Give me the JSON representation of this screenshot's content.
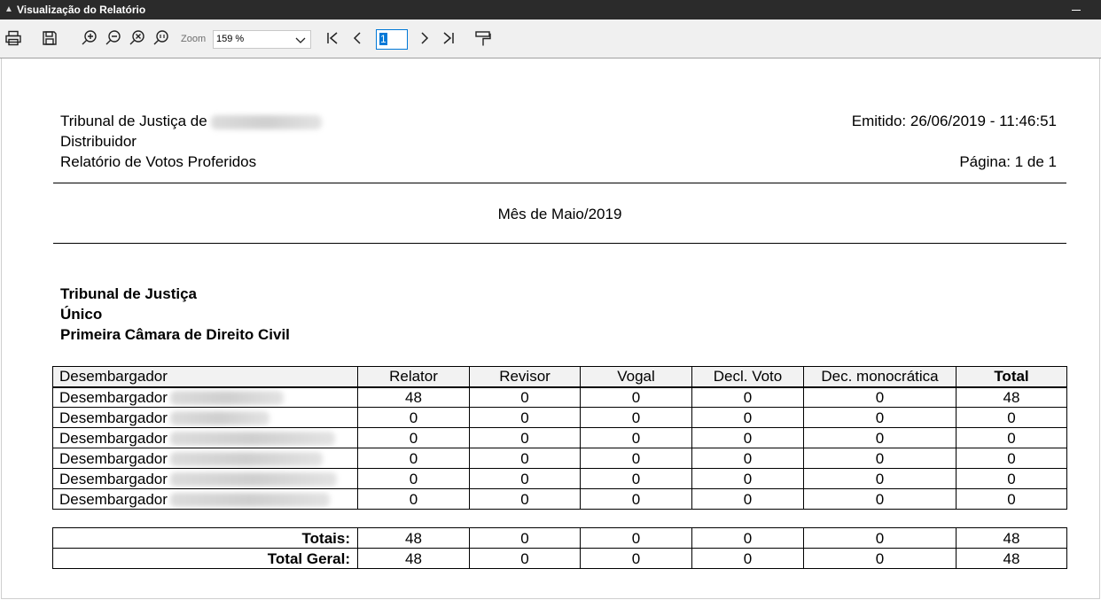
{
  "window": {
    "title": "Visualização do Relatório"
  },
  "toolbar": {
    "zoom_label": "Zoom",
    "zoom_value": "159 %",
    "page_value": "1"
  },
  "report": {
    "header": {
      "line1_prefix": "Tribunal de Justiça de",
      "line2": "Distribuidor",
      "line3": "Relatório de Votos Proferidos",
      "emitted": "Emitido: 26/06/2019 - 11:46:51",
      "page": "Página: 1 de 1"
    },
    "period": "Mês de Maio/2019",
    "section": {
      "line1": "Tribunal de Justiça",
      "line2": "Único",
      "line3": "Primeira Câmara de Direito Civil"
    },
    "table": {
      "columns": [
        "Desembargador",
        "Relator",
        "Revisor",
        "Vogal",
        "Decl. Voto",
        "Dec. monocrática",
        "Total"
      ],
      "rows": [
        {
          "name": "Desembargador",
          "values": [
            "48",
            "0",
            "0",
            "0",
            "0",
            "48"
          ]
        },
        {
          "name": "Desembargador",
          "values": [
            "0",
            "0",
            "0",
            "0",
            "0",
            "0"
          ]
        },
        {
          "name": "Desembargador",
          "values": [
            "0",
            "0",
            "0",
            "0",
            "0",
            "0"
          ]
        },
        {
          "name": "Desembargador",
          "values": [
            "0",
            "0",
            "0",
            "0",
            "0",
            "0"
          ]
        },
        {
          "name": "Desembargador",
          "values": [
            "0",
            "0",
            "0",
            "0",
            "0",
            "0"
          ]
        },
        {
          "name": "Desembargador",
          "values": [
            "0",
            "0",
            "0",
            "0",
            "0",
            "0"
          ]
        }
      ]
    },
    "totals": {
      "totais_label": "Totais:",
      "totais_values": [
        "48",
        "0",
        "0",
        "0",
        "0",
        "48"
      ],
      "geral_label": "Total Geral:",
      "geral_values": [
        "48",
        "0",
        "0",
        "0",
        "0",
        "48"
      ]
    }
  }
}
